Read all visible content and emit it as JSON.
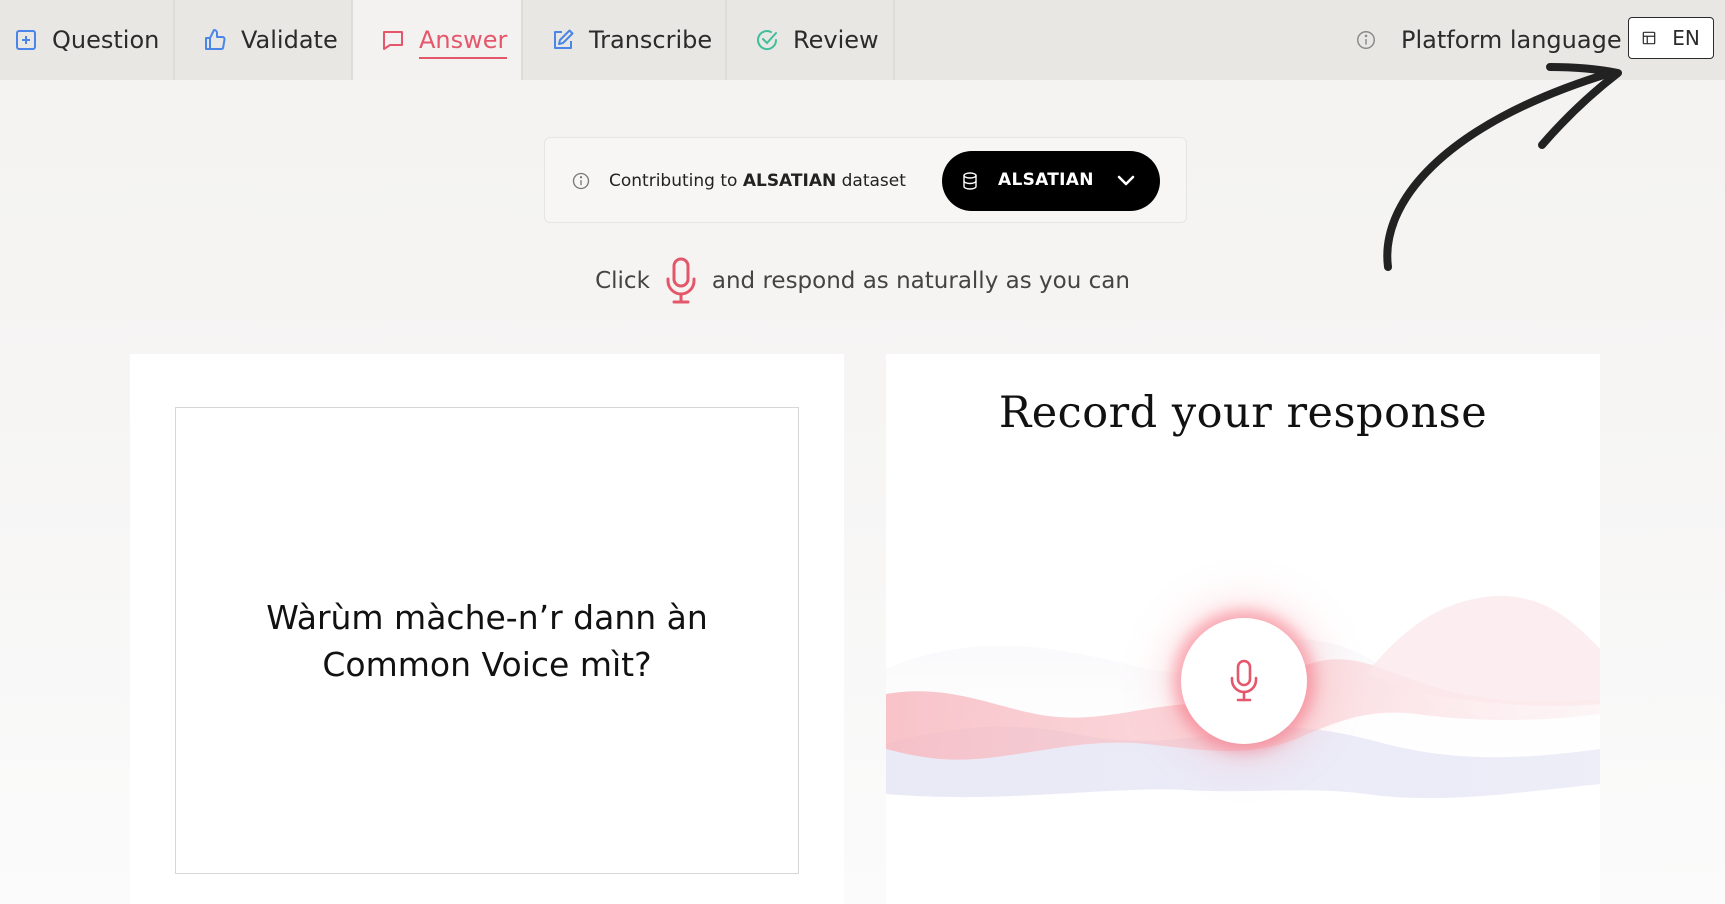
{
  "nav": {
    "tabs": [
      {
        "label": "Question",
        "icon": "plus-square-icon"
      },
      {
        "label": "Validate",
        "icon": "thumbs-up-icon"
      },
      {
        "label": "Answer",
        "icon": "speech-bubble-icon",
        "active": true
      },
      {
        "label": "Transcribe",
        "icon": "pencil-square-icon"
      },
      {
        "label": "Review",
        "icon": "check-circle-icon"
      }
    ],
    "platform_language_label": "Platform language",
    "language_code": "EN"
  },
  "dataset": {
    "prefix": "Contributing to",
    "name": "ALSATIAN",
    "suffix": "dataset",
    "selected": "ALSATIAN"
  },
  "instruction": {
    "before": "Click",
    "after": "and respond as naturally as you can"
  },
  "question": {
    "text": "Wàrùm màche-n’r dann àn Common Voice mìt?"
  },
  "record": {
    "title": "Record your response"
  },
  "colors": {
    "accent": "#e4576a",
    "topbar": "#e8e7e4",
    "dataset_pill": "#000000"
  }
}
